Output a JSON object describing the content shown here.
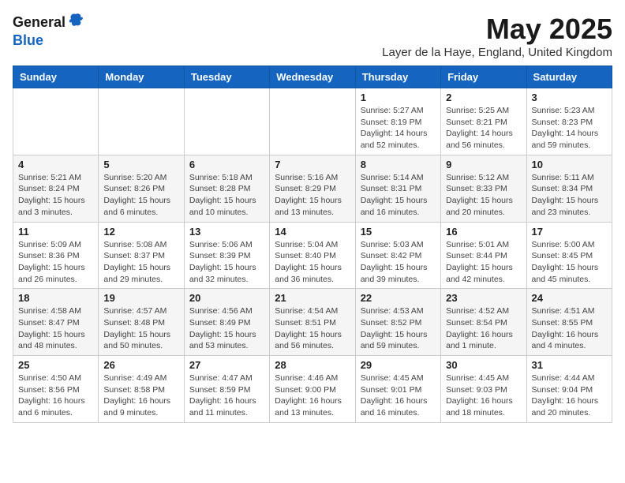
{
  "logo": {
    "general": "General",
    "blue": "Blue"
  },
  "title": "May 2025",
  "location": "Layer de la Haye, England, United Kingdom",
  "headers": [
    "Sunday",
    "Monday",
    "Tuesday",
    "Wednesday",
    "Thursday",
    "Friday",
    "Saturday"
  ],
  "weeks": [
    [
      {
        "day": "",
        "info": ""
      },
      {
        "day": "",
        "info": ""
      },
      {
        "day": "",
        "info": ""
      },
      {
        "day": "",
        "info": ""
      },
      {
        "day": "1",
        "info": "Sunrise: 5:27 AM\nSunset: 8:19 PM\nDaylight: 14 hours\nand 52 minutes."
      },
      {
        "day": "2",
        "info": "Sunrise: 5:25 AM\nSunset: 8:21 PM\nDaylight: 14 hours\nand 56 minutes."
      },
      {
        "day": "3",
        "info": "Sunrise: 5:23 AM\nSunset: 8:23 PM\nDaylight: 14 hours\nand 59 minutes."
      }
    ],
    [
      {
        "day": "4",
        "info": "Sunrise: 5:21 AM\nSunset: 8:24 PM\nDaylight: 15 hours\nand 3 minutes."
      },
      {
        "day": "5",
        "info": "Sunrise: 5:20 AM\nSunset: 8:26 PM\nDaylight: 15 hours\nand 6 minutes."
      },
      {
        "day": "6",
        "info": "Sunrise: 5:18 AM\nSunset: 8:28 PM\nDaylight: 15 hours\nand 10 minutes."
      },
      {
        "day": "7",
        "info": "Sunrise: 5:16 AM\nSunset: 8:29 PM\nDaylight: 15 hours\nand 13 minutes."
      },
      {
        "day": "8",
        "info": "Sunrise: 5:14 AM\nSunset: 8:31 PM\nDaylight: 15 hours\nand 16 minutes."
      },
      {
        "day": "9",
        "info": "Sunrise: 5:12 AM\nSunset: 8:33 PM\nDaylight: 15 hours\nand 20 minutes."
      },
      {
        "day": "10",
        "info": "Sunrise: 5:11 AM\nSunset: 8:34 PM\nDaylight: 15 hours\nand 23 minutes."
      }
    ],
    [
      {
        "day": "11",
        "info": "Sunrise: 5:09 AM\nSunset: 8:36 PM\nDaylight: 15 hours\nand 26 minutes."
      },
      {
        "day": "12",
        "info": "Sunrise: 5:08 AM\nSunset: 8:37 PM\nDaylight: 15 hours\nand 29 minutes."
      },
      {
        "day": "13",
        "info": "Sunrise: 5:06 AM\nSunset: 8:39 PM\nDaylight: 15 hours\nand 32 minutes."
      },
      {
        "day": "14",
        "info": "Sunrise: 5:04 AM\nSunset: 8:40 PM\nDaylight: 15 hours\nand 36 minutes."
      },
      {
        "day": "15",
        "info": "Sunrise: 5:03 AM\nSunset: 8:42 PM\nDaylight: 15 hours\nand 39 minutes."
      },
      {
        "day": "16",
        "info": "Sunrise: 5:01 AM\nSunset: 8:44 PM\nDaylight: 15 hours\nand 42 minutes."
      },
      {
        "day": "17",
        "info": "Sunrise: 5:00 AM\nSunset: 8:45 PM\nDaylight: 15 hours\nand 45 minutes."
      }
    ],
    [
      {
        "day": "18",
        "info": "Sunrise: 4:58 AM\nSunset: 8:47 PM\nDaylight: 15 hours\nand 48 minutes."
      },
      {
        "day": "19",
        "info": "Sunrise: 4:57 AM\nSunset: 8:48 PM\nDaylight: 15 hours\nand 50 minutes."
      },
      {
        "day": "20",
        "info": "Sunrise: 4:56 AM\nSunset: 8:49 PM\nDaylight: 15 hours\nand 53 minutes."
      },
      {
        "day": "21",
        "info": "Sunrise: 4:54 AM\nSunset: 8:51 PM\nDaylight: 15 hours\nand 56 minutes."
      },
      {
        "day": "22",
        "info": "Sunrise: 4:53 AM\nSunset: 8:52 PM\nDaylight: 15 hours\nand 59 minutes."
      },
      {
        "day": "23",
        "info": "Sunrise: 4:52 AM\nSunset: 8:54 PM\nDaylight: 16 hours\nand 1 minute."
      },
      {
        "day": "24",
        "info": "Sunrise: 4:51 AM\nSunset: 8:55 PM\nDaylight: 16 hours\nand 4 minutes."
      }
    ],
    [
      {
        "day": "25",
        "info": "Sunrise: 4:50 AM\nSunset: 8:56 PM\nDaylight: 16 hours\nand 6 minutes."
      },
      {
        "day": "26",
        "info": "Sunrise: 4:49 AM\nSunset: 8:58 PM\nDaylight: 16 hours\nand 9 minutes."
      },
      {
        "day": "27",
        "info": "Sunrise: 4:47 AM\nSunset: 8:59 PM\nDaylight: 16 hours\nand 11 minutes."
      },
      {
        "day": "28",
        "info": "Sunrise: 4:46 AM\nSunset: 9:00 PM\nDaylight: 16 hours\nand 13 minutes."
      },
      {
        "day": "29",
        "info": "Sunrise: 4:45 AM\nSunset: 9:01 PM\nDaylight: 16 hours\nand 16 minutes."
      },
      {
        "day": "30",
        "info": "Sunrise: 4:45 AM\nSunset: 9:03 PM\nDaylight: 16 hours\nand 18 minutes."
      },
      {
        "day": "31",
        "info": "Sunrise: 4:44 AM\nSunset: 9:04 PM\nDaylight: 16 hours\nand 20 minutes."
      }
    ]
  ]
}
